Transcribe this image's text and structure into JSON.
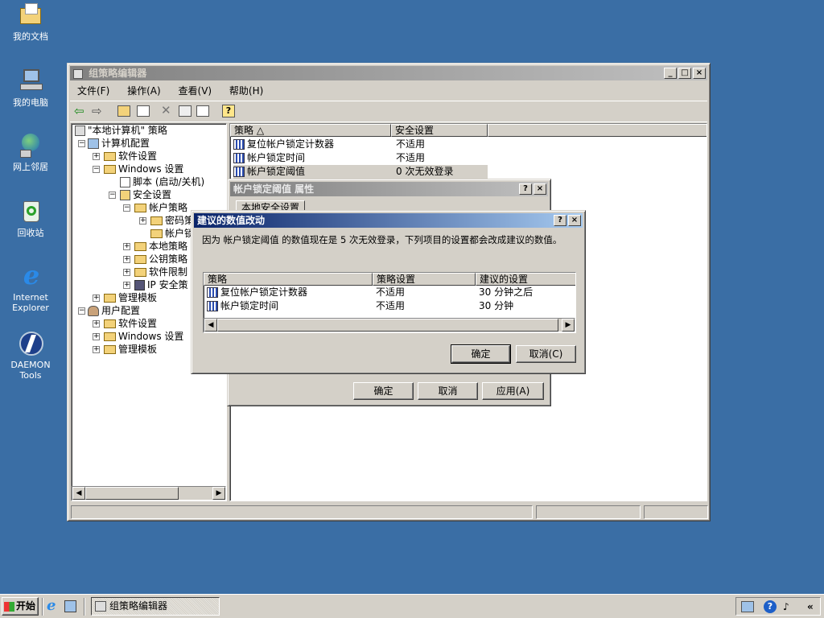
{
  "desktop": {
    "icons": [
      {
        "label": "我的文档"
      },
      {
        "label": "我的电脑"
      },
      {
        "label": "网上邻居"
      },
      {
        "label": "回收站"
      },
      {
        "label": "Internet Explorer"
      },
      {
        "label": "DAEMON Tools"
      }
    ]
  },
  "mainWindow": {
    "title": "组策略编辑器",
    "menu": [
      "文件(F)",
      "操作(A)",
      "查看(V)",
      "帮助(H)"
    ],
    "tree": [
      {
        "label": "\"本地计算机\" 策略"
      },
      {
        "label": "计算机配置"
      },
      {
        "label": "软件设置"
      },
      {
        "label": "Windows 设置"
      },
      {
        "label": "脚本 (启动/关机)"
      },
      {
        "label": "安全设置"
      },
      {
        "label": "帐户策略"
      },
      {
        "label": "密码策"
      },
      {
        "label": "帐户锁"
      },
      {
        "label": "本地策略"
      },
      {
        "label": "公钥策略"
      },
      {
        "label": "软件限制"
      },
      {
        "label": "IP 安全策"
      },
      {
        "label": "管理模板"
      },
      {
        "label": "用户配置"
      },
      {
        "label": "软件设置"
      },
      {
        "label": "Windows 设置"
      },
      {
        "label": "管理模板"
      }
    ],
    "list": {
      "columns": [
        "策略 △",
        "安全设置"
      ],
      "rows": [
        {
          "policy": "复位帐户锁定计数器",
          "setting": "不适用"
        },
        {
          "policy": "帐户锁定时间",
          "setting": "不适用"
        },
        {
          "policy": "帐户锁定阈值",
          "setting": "0 次无效登录"
        }
      ]
    }
  },
  "propsDialog": {
    "title": "帐户锁定阈值 属性",
    "tab": "本地安全设置",
    "buttons": {
      "ok": "确定",
      "cancel": "取消",
      "apply": "应用(A)"
    }
  },
  "suggestDialog": {
    "title": "建议的数值改动",
    "message": "因为 帐户锁定阈值 的数值现在是 5 次无效登录，下列项目的设置都会改成建议的数值。",
    "columns": [
      "策略",
      "策略设置",
      "建议的设置"
    ],
    "rows": [
      {
        "policy": "复位帐户锁定计数器",
        "current": "不适用",
        "suggested": "30 分钟之后"
      },
      {
        "policy": "帐户锁定时间",
        "current": "不适用",
        "suggested": "30 分钟"
      }
    ],
    "buttons": {
      "ok": "确定",
      "cancel": "取消(C)"
    }
  },
  "taskbar": {
    "start": "开始",
    "task": "组策略编辑器"
  }
}
